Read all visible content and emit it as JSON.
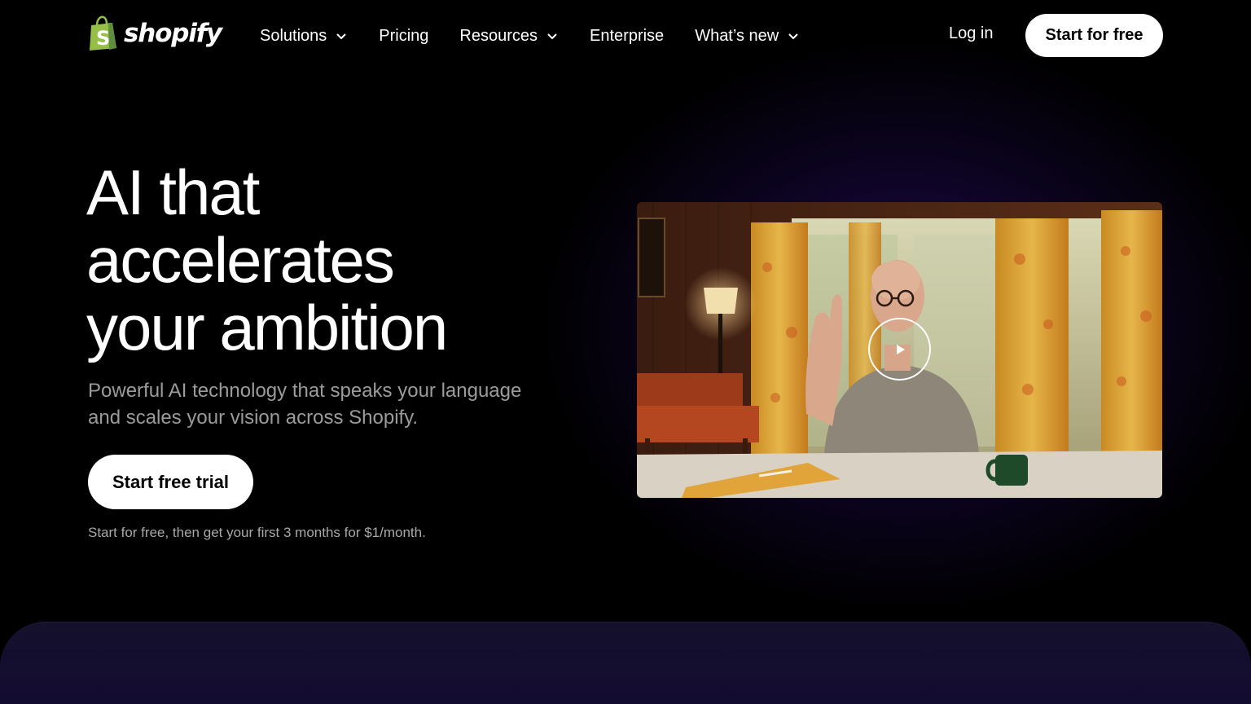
{
  "brand": {
    "name": "shopify",
    "logo_icon": "shopify-bag-icon",
    "logo_color": "#95bf47"
  },
  "nav": {
    "items": [
      {
        "label": "Solutions",
        "has_dropdown": true
      },
      {
        "label": "Pricing",
        "has_dropdown": false
      },
      {
        "label": "Resources",
        "has_dropdown": true
      },
      {
        "label": "Enterprise",
        "has_dropdown": false
      },
      {
        "label": "What’s new",
        "has_dropdown": true
      }
    ],
    "login_label": "Log in",
    "cta_label": "Start for free"
  },
  "hero": {
    "headline_lines": [
      "AI that",
      "accelerates",
      "your ambition"
    ],
    "subhead": "Powerful AI technology that speaks your language and scales your vision across Shopify.",
    "cta_label": "Start free trial",
    "fine_print": "Start for free, then get your first 3 months for $1/month."
  },
  "video": {
    "play_icon": "play-icon"
  },
  "colors": {
    "background": "#000000",
    "accent_purple": "#3c1496",
    "button_bg": "#ffffff",
    "button_text": "#000000"
  }
}
